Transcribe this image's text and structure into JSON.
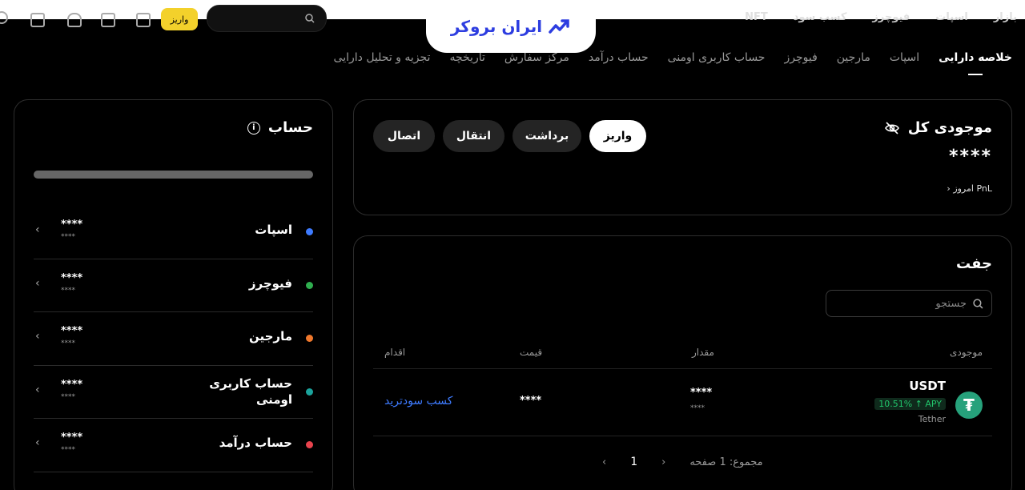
{
  "header": {
    "logo_text": "ایران بروکر",
    "deposit_label": "واریز",
    "menu": [
      "بازار",
      "اسپات",
      "فیوچرز",
      "کسب سود",
      "NFT"
    ],
    "colors": {
      "logo": "#2d3de0",
      "deposit": "#f3d12b"
    }
  },
  "tabs": [
    {
      "label": "خلاصه دارایی",
      "active": true
    },
    {
      "label": "اسپات"
    },
    {
      "label": "مارجین"
    },
    {
      "label": "فیوچرز"
    },
    {
      "label": "حساب کاربری اومنی"
    },
    {
      "label": "حساب درآمد"
    },
    {
      "label": "مرکز سفارش"
    },
    {
      "label": "تاریخچه"
    },
    {
      "label": "تجزیه و تحلیل دارایی"
    }
  ],
  "balance": {
    "title": "موجودی کل",
    "hide_icon": "eye-slash-icon",
    "amount": "****",
    "pnl": "PnL امروز",
    "actions": {
      "deposit": "واریز",
      "withdraw": "برداشت",
      "transfer": "انتقال",
      "connect": "اتصال"
    }
  },
  "pair": {
    "title": "جفت",
    "search_placeholder": "جستجو",
    "columns": {
      "balance": "موجودی",
      "amount": "مقدار",
      "price": "قیمت",
      "action": "اقدام"
    },
    "rows": [
      {
        "symbol": "USDT",
        "name": "Tether",
        "apy": "10.51% ↑ APY",
        "amount": "****",
        "amount_sub": "****",
        "price": "****",
        "action": "کسب سودترید",
        "icon_color": "#26a17b"
      }
    ],
    "pager": {
      "total": "مجموع: 1 صفحه",
      "page": "1"
    }
  },
  "account": {
    "title": "حساب",
    "items": [
      {
        "label": "اسپات",
        "amount": "****",
        "sub": "****",
        "color": "#3e7bff"
      },
      {
        "label": "فیوچرز",
        "amount": "****",
        "sub": "****",
        "color": "#2fae4f"
      },
      {
        "label": "مارجین",
        "amount": "****",
        "sub": "****",
        "color": "#f0782c"
      },
      {
        "label": "حساب کاربری اومنی",
        "amount": "****",
        "sub": "****",
        "color": "#1ba39c"
      },
      {
        "label": "حساب درآمد",
        "amount": "****",
        "sub": "****",
        "color": "#e8434d"
      }
    ]
  }
}
